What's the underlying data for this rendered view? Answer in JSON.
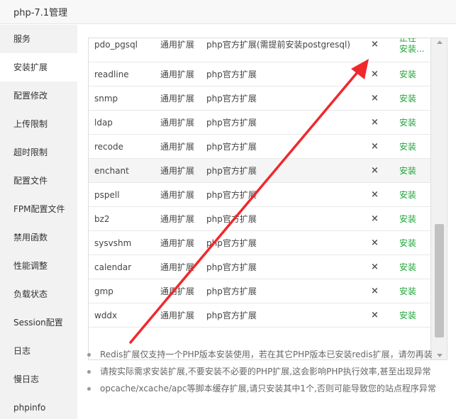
{
  "window": {
    "title": "php-7.1管理"
  },
  "sidebar": {
    "items": [
      {
        "label": "服务"
      },
      {
        "label": "安装扩展"
      },
      {
        "label": "配置修改"
      },
      {
        "label": "上传限制"
      },
      {
        "label": "超时限制"
      },
      {
        "label": "配置文件"
      },
      {
        "label": "FPM配置文件"
      },
      {
        "label": "禁用函数"
      },
      {
        "label": "性能调整"
      },
      {
        "label": "负载状态"
      },
      {
        "label": "Session配置"
      },
      {
        "label": "日志"
      },
      {
        "label": "慢日志"
      },
      {
        "label": "phpinfo"
      }
    ],
    "active_index": 1
  },
  "extensions": {
    "rows": [
      {
        "name": "pdo_pgsql",
        "type": "通用扩展",
        "desc": "php官方扩展(需提前安装postgresql)",
        "status_icon": "×",
        "action": "正在\n安装..."
      },
      {
        "name": "readline",
        "type": "通用扩展",
        "desc": "php官方扩展",
        "status_icon": "×",
        "action": "安装"
      },
      {
        "name": "snmp",
        "type": "通用扩展",
        "desc": "php官方扩展",
        "status_icon": "×",
        "action": "安装"
      },
      {
        "name": "ldap",
        "type": "通用扩展",
        "desc": "php官方扩展",
        "status_icon": "×",
        "action": "安装"
      },
      {
        "name": "recode",
        "type": "通用扩展",
        "desc": "php官方扩展",
        "status_icon": "×",
        "action": "安装"
      },
      {
        "name": "enchant",
        "type": "通用扩展",
        "desc": "php官方扩展",
        "status_icon": "×",
        "action": "安装"
      },
      {
        "name": "pspell",
        "type": "通用扩展",
        "desc": "php官方扩展",
        "status_icon": "×",
        "action": "安装"
      },
      {
        "name": "bz2",
        "type": "通用扩展",
        "desc": "php官方扩展",
        "status_icon": "×",
        "action": "安装"
      },
      {
        "name": "sysvshm",
        "type": "通用扩展",
        "desc": "php官方扩展",
        "status_icon": "×",
        "action": "安装"
      },
      {
        "name": "calendar",
        "type": "通用扩展",
        "desc": "php官方扩展",
        "status_icon": "×",
        "action": "安装"
      },
      {
        "name": "gmp",
        "type": "通用扩展",
        "desc": "php官方扩展",
        "status_icon": "×",
        "action": "安装"
      },
      {
        "name": "wddx",
        "type": "通用扩展",
        "desc": "php官方扩展",
        "status_icon": "×",
        "action": "安装"
      }
    ]
  },
  "notes": [
    "Redis扩展仅支持一个PHP版本安装使用，若在其它PHP版本已安装redis扩展，请勿再装",
    "请按实际需求安装扩展,不要安装不必要的PHP扩展,这会影响PHP执行效率,甚至出现异常",
    "opcache/xcache/apc等脚本缓存扩展,请只安装其中1个,否则可能导致您的站点程序异常"
  ],
  "colors": {
    "accent_green": "#20a53a",
    "annotation_red": "#f0282d",
    "sidebar_bg": "#f2f2f2"
  },
  "icons": {
    "status": "close-icon",
    "annotation": "red-arrow-annotation"
  }
}
